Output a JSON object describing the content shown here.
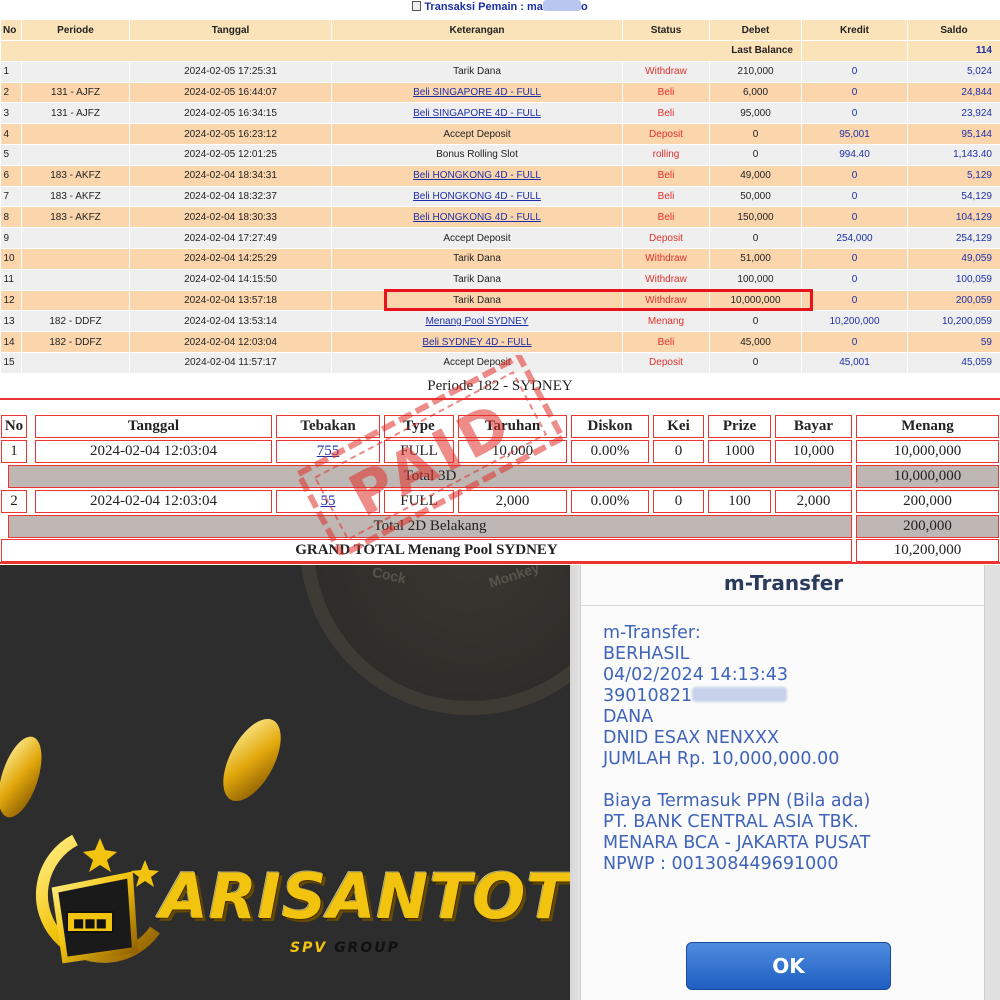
{
  "header": {
    "title_prefix": "Transaksi  Pemain : ma",
    "title_suffix": "o"
  },
  "transactions": {
    "columns": [
      "No",
      "Periode",
      "Tanggal",
      "Keterangan",
      "Status",
      "Debet",
      "Kredit",
      "Saldo"
    ],
    "last_balance_label": "Last Balance",
    "last_balance_value": "114",
    "rows": [
      {
        "no": "1",
        "periode": "",
        "tanggal": "2024-02-05 17:25:31",
        "keterangan": "Tarik Dana",
        "link": false,
        "status": "Withdraw",
        "debet": "210,000",
        "kredit": "0",
        "saldo": "5,024"
      },
      {
        "no": "2",
        "periode": "131 - AJFZ",
        "tanggal": "2024-02-05 16:44:07",
        "keterangan": "Beli SINGAPORE 4D - FULL",
        "link": true,
        "status": "Beli",
        "debet": "6,000",
        "kredit": "0",
        "saldo": "24,844"
      },
      {
        "no": "3",
        "periode": "131 - AJFZ",
        "tanggal": "2024-02-05 16:34:15",
        "keterangan": "Beli SINGAPORE 4D - FULL",
        "link": true,
        "status": "Beli",
        "debet": "95,000",
        "kredit": "0",
        "saldo": "23,924"
      },
      {
        "no": "4",
        "periode": "",
        "tanggal": "2024-02-05 16:23:12",
        "keterangan": "Accept Deposit",
        "link": false,
        "status": "Deposit",
        "debet": "0",
        "kredit": "95,001",
        "saldo": "95,144"
      },
      {
        "no": "5",
        "periode": "",
        "tanggal": "2024-02-05 12:01:25",
        "keterangan": "Bonus Rolling Slot",
        "link": false,
        "status": "rolling",
        "debet": "0",
        "kredit": "994.40",
        "saldo": "1,143.40"
      },
      {
        "no": "6",
        "periode": "183 - AKFZ",
        "tanggal": "2024-02-04 18:34:31",
        "keterangan": "Beli HONGKONG 4D - FULL",
        "link": true,
        "status": "Beli",
        "debet": "49,000",
        "kredit": "0",
        "saldo": "5,129"
      },
      {
        "no": "7",
        "periode": "183 - AKFZ",
        "tanggal": "2024-02-04 18:32:37",
        "keterangan": "Beli HONGKONG 4D - FULL",
        "link": true,
        "status": "Beli",
        "debet": "50,000",
        "kredit": "0",
        "saldo": "54,129"
      },
      {
        "no": "8",
        "periode": "183 - AKFZ",
        "tanggal": "2024-02-04 18:30:33",
        "keterangan": "Beli HONGKONG 4D - FULL",
        "link": true,
        "status": "Beli",
        "debet": "150,000",
        "kredit": "0",
        "saldo": "104,129"
      },
      {
        "no": "9",
        "periode": "",
        "tanggal": "2024-02-04 17:27:49",
        "keterangan": "Accept Deposit",
        "link": false,
        "status": "Deposit",
        "debet": "0",
        "kredit": "254,000",
        "saldo": "254,129"
      },
      {
        "no": "10",
        "periode": "",
        "tanggal": "2024-02-04 14:25:29",
        "keterangan": "Tarik Dana",
        "link": false,
        "status": "Withdraw",
        "debet": "51,000",
        "kredit": "0",
        "saldo": "49,059"
      },
      {
        "no": "11",
        "periode": "",
        "tanggal": "2024-02-04 14:15:50",
        "keterangan": "Tarik Dana",
        "link": false,
        "status": "Withdraw",
        "debet": "100,000",
        "kredit": "0",
        "saldo": "100,059"
      },
      {
        "no": "12",
        "periode": "",
        "tanggal": "2024-02-04 13:57:18",
        "keterangan": "Tarik Dana",
        "link": false,
        "status": "Withdraw",
        "debet": "10,000,000",
        "kredit": "0",
        "saldo": "200,059"
      },
      {
        "no": "13",
        "periode": "182 - DDFZ",
        "tanggal": "2024-02-04 13:53:14",
        "keterangan": "Menang Pool SYDNEY",
        "link": true,
        "status": "Menang",
        "debet": "0",
        "kredit": "10,200,000",
        "saldo": "10,200,059"
      },
      {
        "no": "14",
        "periode": "182 - DDFZ",
        "tanggal": "2024-02-04 12:03:04",
        "keterangan": "Beli SYDNEY 4D - FULL",
        "link": true,
        "status": "Beli",
        "debet": "45,000",
        "kredit": "0",
        "saldo": "59"
      },
      {
        "no": "15",
        "periode": "",
        "tanggal": "2024-02-04 11:57:17",
        "keterangan": "Accept Deposit",
        "link": false,
        "status": "Deposit",
        "debet": "0",
        "kredit": "45,001",
        "saldo": "45,059"
      }
    ]
  },
  "periode": {
    "title": "Periode 182 - SYDNEY",
    "columns": [
      "No",
      "Tanggal",
      "Tebakan",
      "Type",
      "Taruhan",
      "Diskon",
      "Kei",
      "Prize",
      "Bayar",
      "Menang"
    ],
    "bets": [
      {
        "no": "1",
        "tanggal": "2024-02-04 12:03:04",
        "tebakan": "755",
        "type": "FULL",
        "taruhan": "10,000",
        "diskon": "0.00%",
        "kei": "0",
        "prize": "1000",
        "bayar": "10,000",
        "menang": "10,000,000"
      },
      {
        "no": "2",
        "tanggal": "2024-02-04 12:03:04",
        "tebakan": "55",
        "type": "FULL",
        "taruhan": "2,000",
        "diskon": "0.00%",
        "kei": "0",
        "prize": "100",
        "bayar": "2,000",
        "menang": "200,000"
      }
    ],
    "total_3d_label": "Total 3D",
    "total_3d_value": "10,000,000",
    "total_2d_label": "Total 2D Belakang",
    "total_2d_value": "200,000",
    "grand_total_label": "GRAND TOTAL  Menang Pool SYDNEY",
    "grand_total_value": "10,200,000"
  },
  "stamp": {
    "text": "PAID"
  },
  "brand": {
    "name": "ARISANTOTO",
    "sub_prefix": "SPV",
    "sub_suffix": "GROUP",
    "wheel_words": [
      "Cock",
      "Monkey"
    ]
  },
  "receipt": {
    "title": "m-Transfer",
    "lines": [
      "m-Transfer:",
      "BERHASIL",
      "04/02/2024 14:13:43",
      "39010821",
      "DANA",
      "DNID ESAX NENXXX",
      "JUMLAH Rp. 10,000,000.00"
    ],
    "footer_lines": [
      "Biaya Termasuk PPN (Bila ada)",
      "PT. BANK CENTRAL ASIA TBK.",
      "MENARA BCA - JAKARTA PUSAT",
      "NPWP : 001308449691000"
    ],
    "ok_label": "OK"
  },
  "colors": {
    "header_bg": "#fbe3b9",
    "row_alt_bg": "#fbd6ad",
    "row_bg": "#efefef",
    "link_blue": "#1c2fa8",
    "status_red": "#e0302a",
    "highlight_red": "#e8141c",
    "brand_gold": "#f2c40f",
    "receipt_blue": "#3f64b8"
  }
}
